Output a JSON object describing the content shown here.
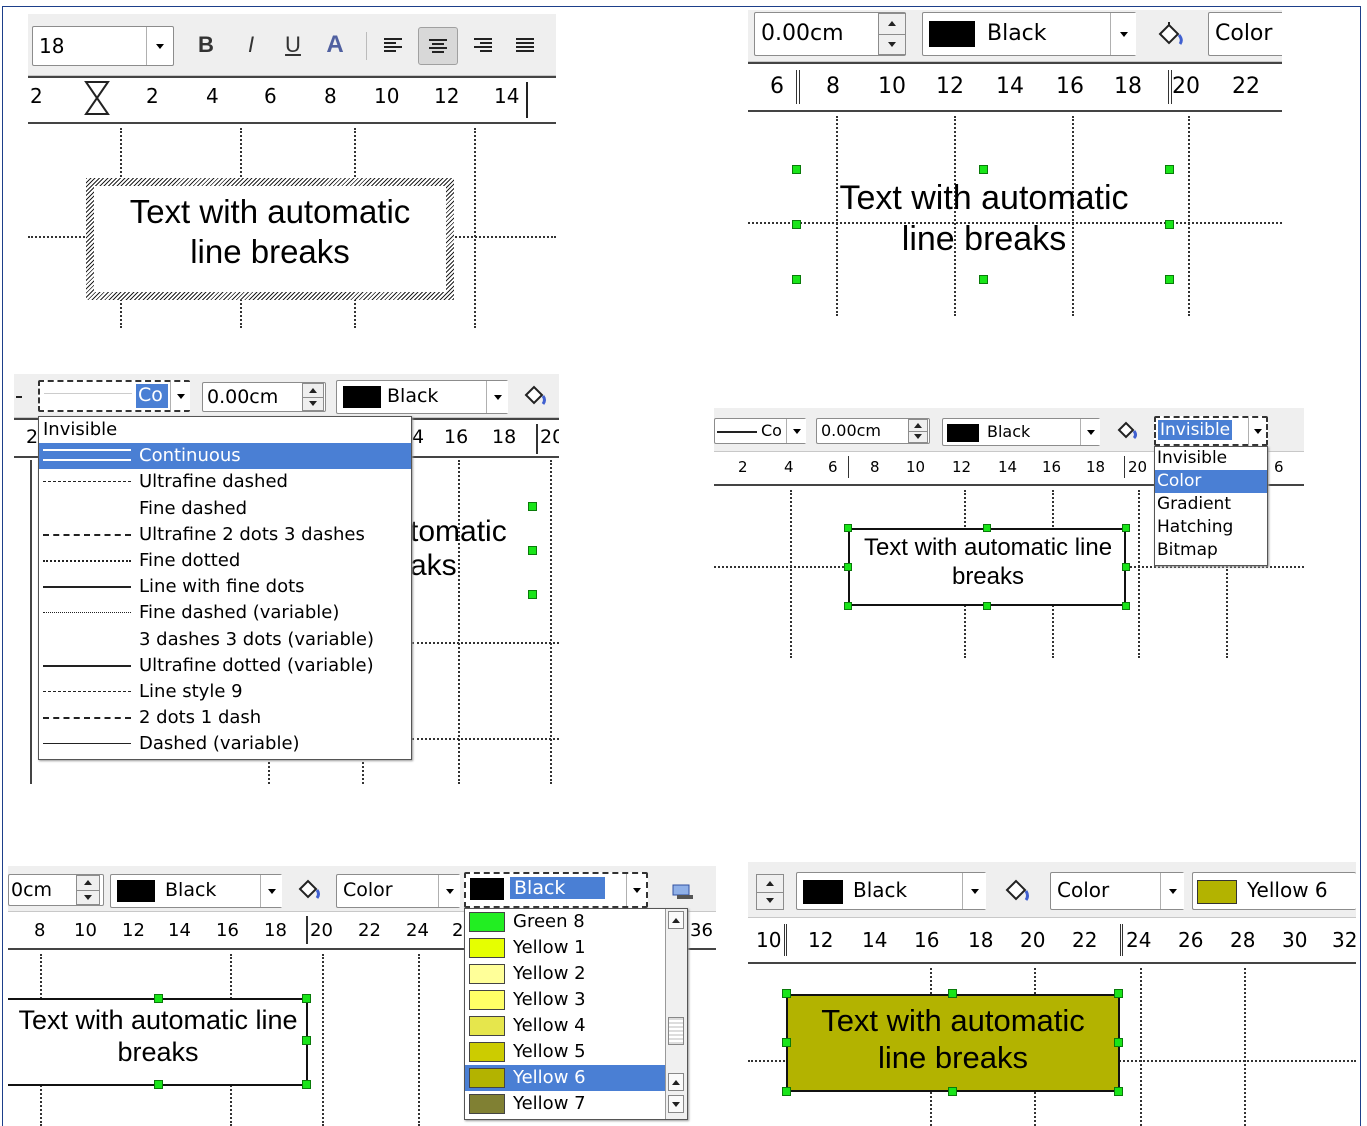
{
  "common": {
    "box_text": "Text with automatic line breaks",
    "handle_color": "#19e519",
    "selection_color": "#4a7fd4",
    "fill_yellow6": "#b3b300"
  },
  "panel1": {
    "font_size": "18",
    "bold": "B",
    "italic": "I",
    "underline": "U",
    "shadow": "A",
    "ruler": [
      "2",
      "2",
      "4",
      "6",
      "8",
      "10",
      "12",
      "14"
    ]
  },
  "panel2": {
    "line_width": "0.00cm",
    "line_color": "Black",
    "area_style": "Color",
    "ruler": [
      "6",
      "8",
      "10",
      "12",
      "14",
      "16",
      "18",
      "20",
      "22"
    ]
  },
  "panel3": {
    "line_style_value": "Co",
    "line_width": "0.00cm",
    "line_color": "Black",
    "ruler_tail": [
      "4",
      "16",
      "18",
      "20"
    ],
    "ruler_head": "2",
    "box_text_partial": [
      "tomatic",
      "aks"
    ],
    "line_styles": [
      "Invisible",
      "Continuous",
      "Ultrafine dashed",
      "Fine dashed",
      "Ultrafine 2 dots 3 dashes",
      "Fine dotted",
      "Line with fine dots",
      "Fine dashed (variable)",
      "3 dashes 3 dots (variable)",
      "Ultrafine dotted (variable)",
      "Line style 9",
      "2 dots 1 dash",
      "Dashed (variable)"
    ],
    "selected_index": 1
  },
  "panel4": {
    "line_style_value": "Co",
    "line_width": "0.00cm",
    "line_color": "Black",
    "area_style_value": "Invisible",
    "ruler": [
      "2",
      "4",
      "6",
      "8",
      "10",
      "12",
      "14",
      "16",
      "18",
      "20",
      "6"
    ],
    "area_styles": [
      "Invisible",
      "Color",
      "Gradient",
      "Hatching",
      "Bitmap"
    ],
    "selected_index": 1
  },
  "panel5": {
    "line_width": "0cm",
    "line_color": "Black",
    "area_style": "Color",
    "fill_value": "Black",
    "ruler": [
      "8",
      "10",
      "12",
      "14",
      "16",
      "18",
      "20",
      "22",
      "24",
      "2",
      "36"
    ],
    "colors": [
      {
        "name": "Green 8",
        "hex": "#22ee22"
      },
      {
        "name": "Yellow 1",
        "hex": "#e6ff00"
      },
      {
        "name": "Yellow 2",
        "hex": "#ffff99"
      },
      {
        "name": "Yellow 3",
        "hex": "#ffff66"
      },
      {
        "name": "Yellow 4",
        "hex": "#e6e64c"
      },
      {
        "name": "Yellow 5",
        "hex": "#cccc00"
      },
      {
        "name": "Yellow 6",
        "hex": "#b3b300"
      },
      {
        "name": "Yellow 7",
        "hex": "#808033"
      }
    ],
    "selected_index": 6
  },
  "panel6": {
    "line_color": "Black",
    "area_style": "Color",
    "fill_value": "Yellow 6",
    "ruler": [
      "10",
      "12",
      "14",
      "16",
      "18",
      "20",
      "22",
      "24",
      "26",
      "28",
      "30",
      "32"
    ]
  }
}
